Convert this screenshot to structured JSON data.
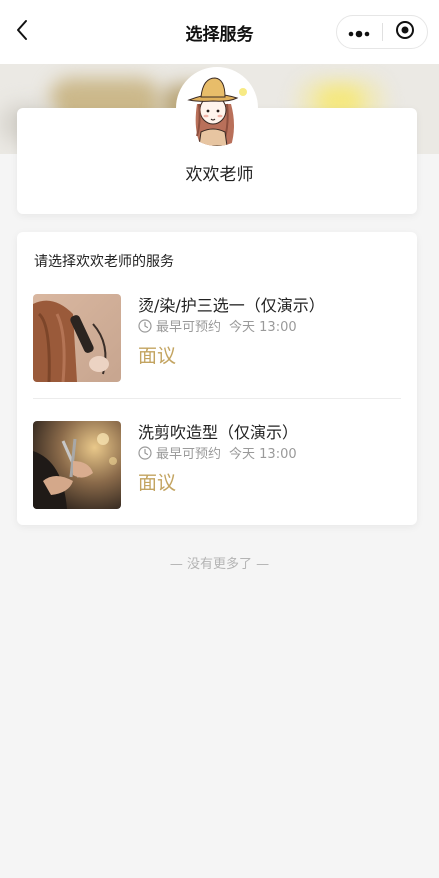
{
  "navbar": {
    "title": "选择服务",
    "back_icon": "chevron-left-icon",
    "more_icon": "more-dots-icon",
    "close_icon": "target-circle-icon"
  },
  "teacher": {
    "name": "欢欢老师",
    "avatar": "cartoon-girl-avatar"
  },
  "services": {
    "heading": "请选择欢欢老师的服务",
    "items": [
      {
        "title": "烫/染/护三选一（仅演示）",
        "time_label": "最早可预约",
        "time_value": "今天 13:00",
        "price": "面议",
        "image": "hair-curling-photo"
      },
      {
        "title": "洗剪吹造型（仅演示）",
        "time_label": "最早可预约",
        "time_value": "今天 13:00",
        "price": "面议",
        "image": "hair-cutting-photo"
      }
    ]
  },
  "footer": {
    "no_more": "— 没有更多了 —"
  },
  "colors": {
    "accent_price": "#c3a461",
    "background": "#f5f5f5",
    "muted_text": "#9a9a9a"
  }
}
